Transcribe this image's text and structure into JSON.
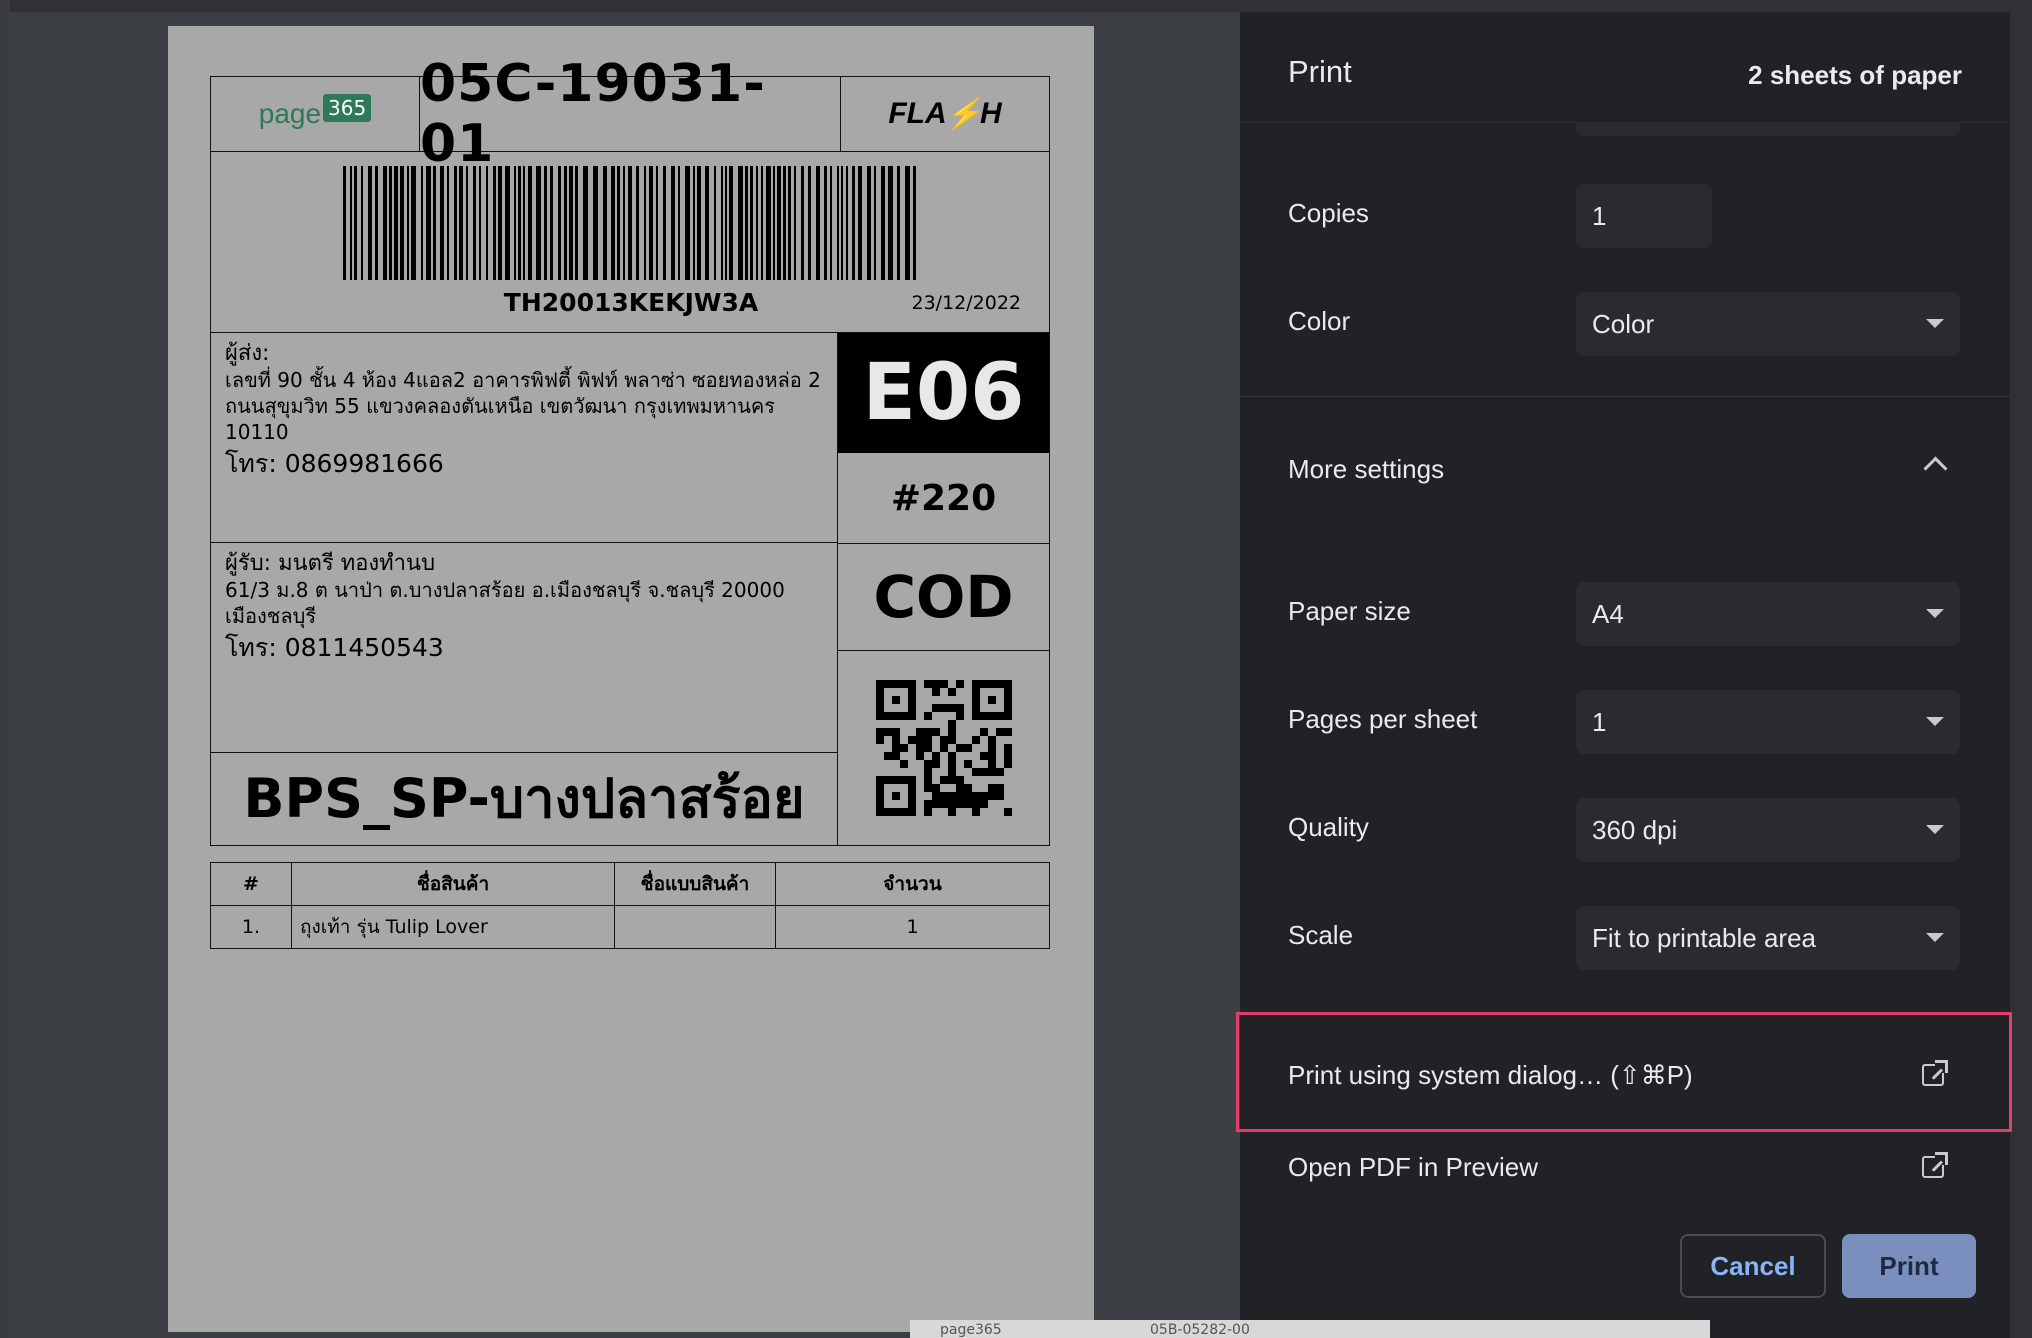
{
  "print_panel": {
    "title": "Print",
    "sheets_info": "2 sheets of paper",
    "copies": {
      "label": "Copies",
      "value": "1"
    },
    "color": {
      "label": "Color",
      "value": "Color"
    },
    "more_settings_label": "More settings",
    "paper_size": {
      "label": "Paper size",
      "value": "A4"
    },
    "pages_per_sheet": {
      "label": "Pages per sheet",
      "value": "1"
    },
    "quality": {
      "label": "Quality",
      "value": "360 dpi"
    },
    "scale": {
      "label": "Scale",
      "value": "Fit to printable area"
    },
    "system_dialog_label": "Print using system dialog… (⇧⌘P)",
    "open_pdf_label": "Open PDF in Preview",
    "cancel_label": "Cancel",
    "print_label": "Print",
    "highlight_color": "#e23d6b",
    "accent_color": "#8ab4f8"
  },
  "label": {
    "logo_text": "page",
    "logo_badge": "365",
    "order_code": "05C-19031-01",
    "carrier_logo_left": "FLA",
    "carrier_logo_bolt": "⚡",
    "carrier_logo_right": "H",
    "tracking_number": "TH20013KEKJW3A",
    "date": "23/12/2022",
    "sender_heading": "ผู้ส่ง:",
    "sender_address": "เลขที่ 90 ชั้น 4 ห้อง 4แอล2 อาคารพิฟตี้ พิฟท์ พลาซ่า ซอยทองหล่อ 2 ถนนสุขุมวิท 55 แขวงคลองตันเหนือ เขตวัฒนา กรุงเทพมหานคร 10110",
    "sender_phone": "โทร: 0869981666",
    "receiver_heading": "ผู้รับ: มนตรี ทองทำนบ",
    "receiver_address": "61/3 ม.8 ต นาป่า ต.บางปลาสร้อย อ.เมืองชลบุรี จ.ชลบุรี 20000 เมืองชลบุรี",
    "receiver_phone": "โทร: 0811450543",
    "destination_branch": "BPS_SP-บางปลาสร้อย",
    "zone_code": "E06",
    "sort_code": "#220",
    "payment_type": "COD",
    "items_table": {
      "headers": [
        "#",
        "ชื่อสินค้า",
        "ชื่อแบบสินค้า",
        "จำนวน"
      ],
      "rows": [
        [
          "1.",
          "ถุงเท้า รุ่น Tulip Lover",
          "",
          "1"
        ]
      ]
    }
  },
  "background_peek": {
    "left_text": "page365",
    "right_text": "05B-05282-00"
  }
}
